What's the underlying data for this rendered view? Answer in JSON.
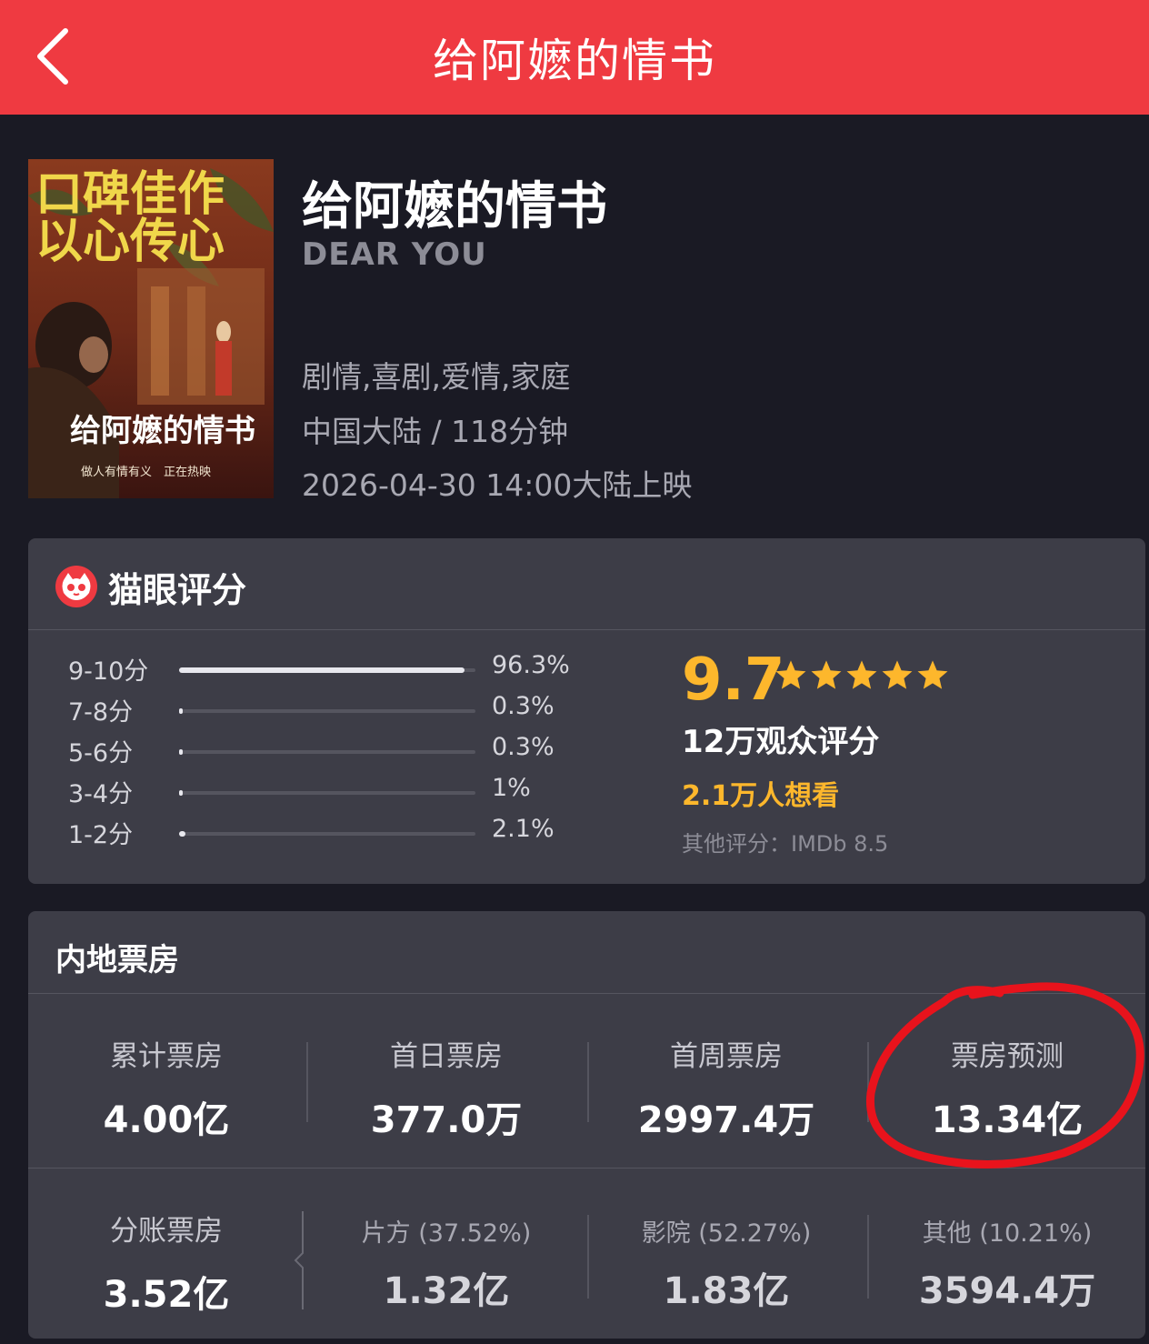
{
  "header": {
    "title": "给阿嬷的情书",
    "back_icon": "chevron-left-icon"
  },
  "colors": {
    "header_bg": "#ef3a41",
    "page_bg": "#1a1a24",
    "card_bg": "#3d3d47",
    "accent": "#fdb72c",
    "annotation": "#e8131c"
  },
  "movie": {
    "poster_text_line1": "口碑佳作",
    "poster_text_line2": "以心传心",
    "poster_title": "给阿嬷的情书",
    "poster_tagline": "做人有情有义　正在热映",
    "title": "给阿嬷的情书",
    "english_title": "DEAR YOU",
    "genres": "剧情,喜剧,爱情,家庭",
    "region_duration": "中国大陆 / 118分钟",
    "release": "2026-04-30 14:00大陆上映"
  },
  "rating": {
    "heading": "猫眼评分",
    "distribution": [
      {
        "label": "9-10分",
        "percent_text": "96.3%",
        "value": 96.3
      },
      {
        "label": "7-8分",
        "percent_text": "0.3%",
        "value": 0.3
      },
      {
        "label": "5-6分",
        "percent_text": "0.3%",
        "value": 0.3
      },
      {
        "label": "3-4分",
        "percent_text": "1%",
        "value": 1
      },
      {
        "label": "1-2分",
        "percent_text": "2.1%",
        "value": 2.1
      }
    ],
    "score": "9.7",
    "stars": 5,
    "audience_count": "12万观众评分",
    "want_to_see": "2.1万人想看",
    "other_rating": "其他评分：IMDb 8.5"
  },
  "box_office": {
    "heading": "内地票房",
    "row1": [
      {
        "label": "累计票房",
        "value": "4.00亿"
      },
      {
        "label": "首日票房",
        "value": "377.0万"
      },
      {
        "label": "首周票房",
        "value": "2997.4万"
      },
      {
        "label": "票房预测",
        "value": "13.34亿"
      }
    ],
    "split": {
      "label": "分账票房",
      "value": "3.52亿"
    },
    "row2": [
      {
        "label": "片方 (37.52%)",
        "value": "1.32亿"
      },
      {
        "label": "影院 (52.27%)",
        "value": "1.83亿"
      },
      {
        "label": "其他 (10.21%)",
        "value": "3594.4万"
      }
    ]
  }
}
